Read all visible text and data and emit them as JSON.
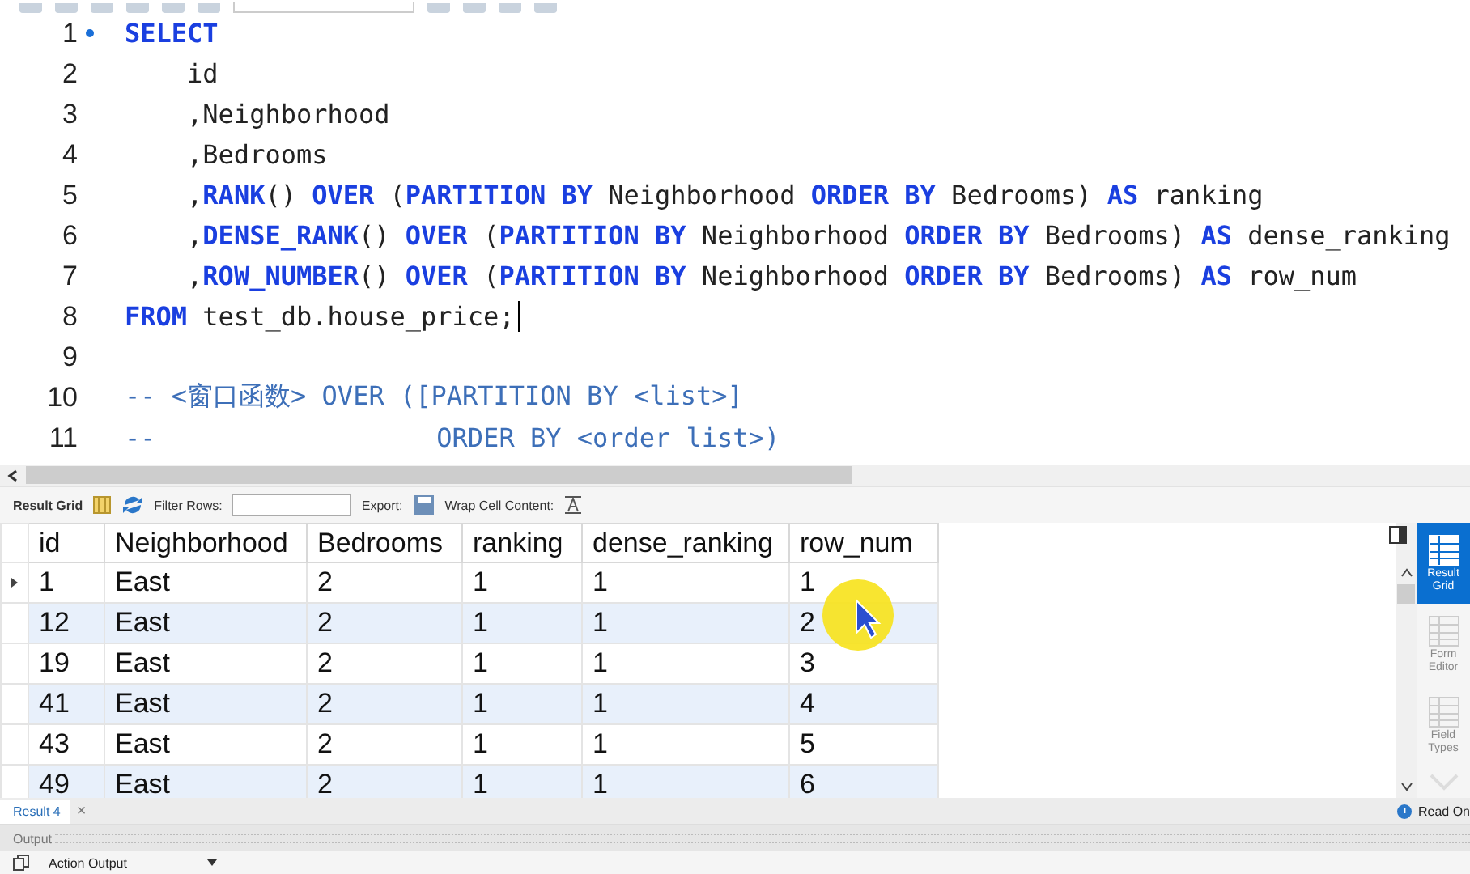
{
  "editor": {
    "lines": [
      {
        "number": "1",
        "marker": true,
        "kind": "code",
        "caret": false,
        "text": "**SELECT**"
      },
      {
        "number": "2",
        "marker": false,
        "kind": "code",
        "caret": false,
        "text": "    id"
      },
      {
        "number": "3",
        "marker": false,
        "kind": "code",
        "caret": false,
        "text": "    ,Neighborhood"
      },
      {
        "number": "4",
        "marker": false,
        "kind": "code",
        "caret": false,
        "text": "    ,Bedrooms"
      },
      {
        "number": "5",
        "marker": false,
        "kind": "code",
        "caret": false,
        "text": "    ,**RANK**() **OVER** (**PARTITION BY** Neighborhood **ORDER BY** Bedrooms) **AS** ranking"
      },
      {
        "number": "6",
        "marker": false,
        "kind": "code",
        "caret": false,
        "text": "    ,**DENSE_RANK**() **OVER** (**PARTITION BY** Neighborhood **ORDER BY** Bedrooms) **AS** dense_ranking"
      },
      {
        "number": "7",
        "marker": false,
        "kind": "code",
        "caret": false,
        "text": "    ,**ROW_NUMBER**() **OVER** (**PARTITION BY** Neighborhood **ORDER BY** Bedrooms) **AS** row_num"
      },
      {
        "number": "8",
        "marker": false,
        "kind": "code",
        "caret": true,
        "text": "**FROM** test_db.house_price;"
      },
      {
        "number": "9",
        "marker": false,
        "kind": "blank",
        "caret": false
      },
      {
        "number": "10",
        "marker": false,
        "kind": "comment",
        "caret": false,
        "text": "-- <窗口函数> OVER ([PARTITION BY <list>]"
      },
      {
        "number": "11",
        "marker": false,
        "kind": "comment",
        "caret": false,
        "text": "--                  ORDER BY <order list>)"
      }
    ]
  },
  "result_toolbar": {
    "result_grid": "Result Grid",
    "filter_label": "Filter Rows:",
    "export_label": "Export:",
    "wrap_label": "Wrap Cell Content:"
  },
  "grid": {
    "columns": [
      "id",
      "Neighborhood",
      "Bedrooms",
      "ranking",
      "dense_ranking",
      "row_num"
    ],
    "rows": [
      {
        "selected": true,
        "cells": [
          "1",
          "East",
          "2",
          "1",
          "1",
          "1"
        ]
      },
      {
        "selected": false,
        "cells": [
          "12",
          "East",
          "2",
          "1",
          "1",
          "2"
        ]
      },
      {
        "selected": false,
        "cells": [
          "19",
          "East",
          "2",
          "1",
          "1",
          "3"
        ]
      },
      {
        "selected": false,
        "cells": [
          "41",
          "East",
          "2",
          "1",
          "1",
          "4"
        ]
      },
      {
        "selected": false,
        "cells": [
          "43",
          "East",
          "2",
          "1",
          "1",
          "5"
        ]
      },
      {
        "selected": false,
        "cells": [
          "49",
          "East",
          "2",
          "1",
          "1",
          "6"
        ]
      }
    ]
  },
  "side_panel": [
    {
      "label": "Result Grid",
      "selected": true
    },
    {
      "label": "Form Editor",
      "selected": false
    },
    {
      "label": "Field Types",
      "selected": false
    }
  ],
  "result_tab": {
    "label": "Result 4",
    "close": "×"
  },
  "status": "Read On",
  "output": {
    "title": "Output",
    "selector": "Action Output"
  }
}
